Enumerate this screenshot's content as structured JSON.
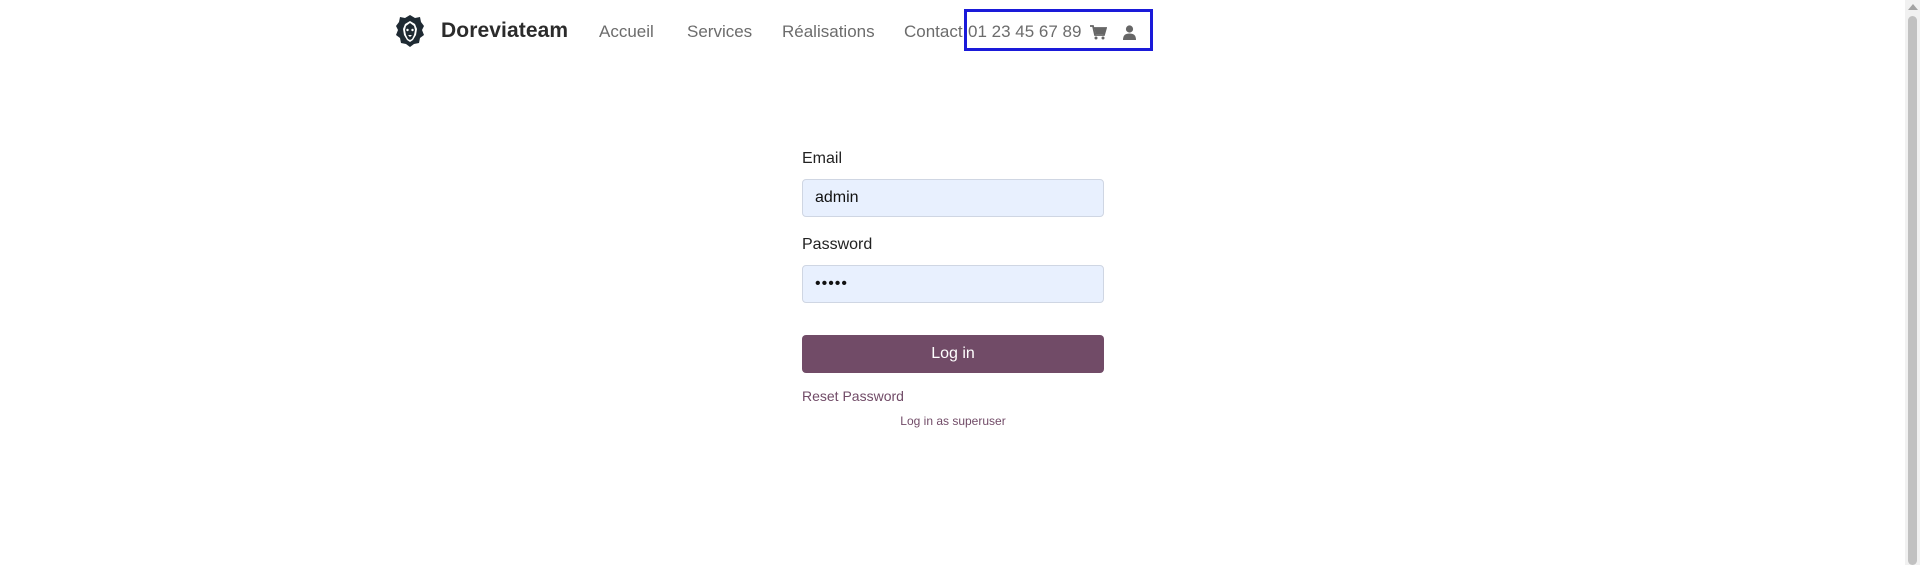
{
  "header": {
    "brand_name": "Doreviateam",
    "logo_icon": "lion-head-icon",
    "nav": {
      "accueil": "Accueil",
      "services": "Services",
      "realisations": "Réalisations",
      "contact": "Contact"
    },
    "phone": "01 23 45 67 89",
    "cart_icon": "cart-icon",
    "user_icon": "user-icon",
    "highlight_color": "#1a1ad9"
  },
  "login_form": {
    "email_label": "Email",
    "email_value": "admin",
    "password_label": "Password",
    "password_value": "admin",
    "submit_label": "Log in",
    "reset_link": "Reset Password",
    "superuser_link": "Log in as superuser",
    "accent_color": "#714b67",
    "input_bg_color": "#e8f0fe"
  }
}
